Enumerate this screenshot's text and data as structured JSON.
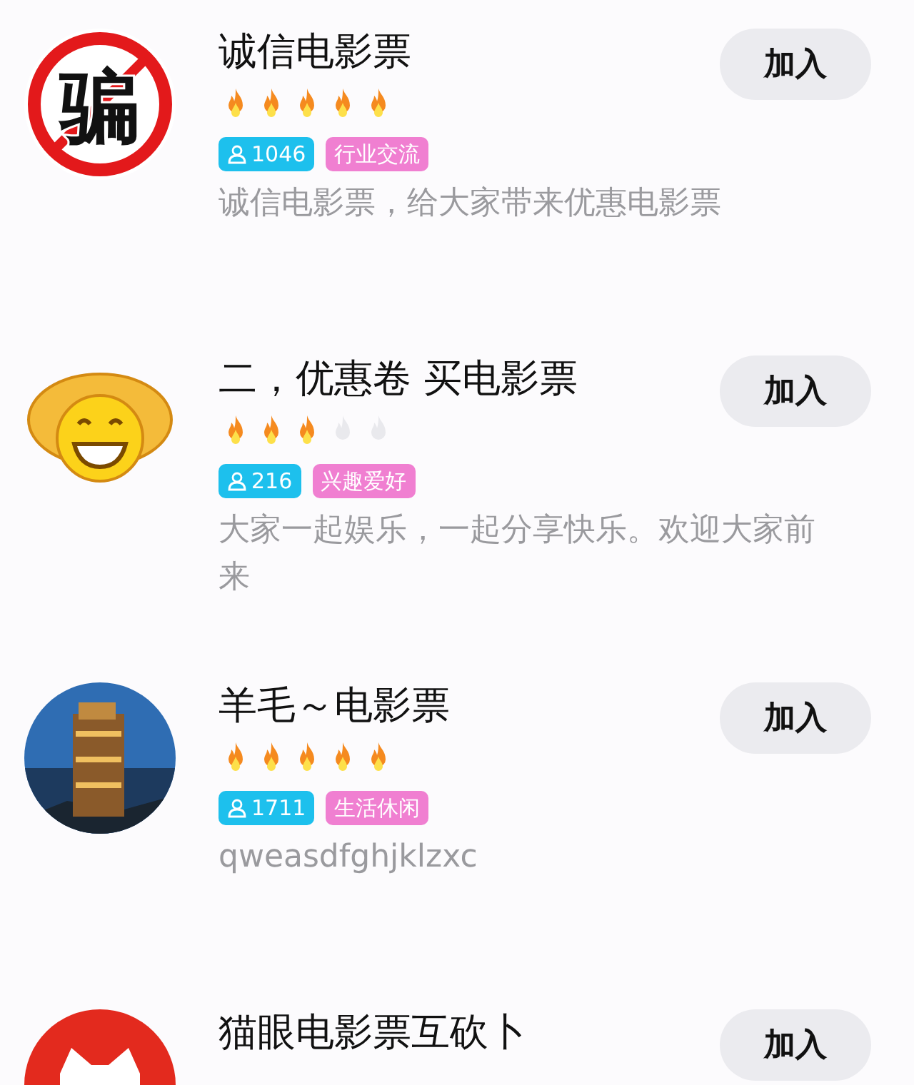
{
  "groups": [
    {
      "avatar": {
        "kind": "ban",
        "text": "骗"
      },
      "title": "诚信电影票",
      "stars": 5,
      "members": "1046",
      "category": "行业交流",
      "description": "诚信电影票，给大家带来优惠电影票",
      "button": "加入"
    },
    {
      "avatar": {
        "kind": "smiley"
      },
      "title": "二，优惠卷 买电影票",
      "stars": 3,
      "members": "216",
      "category": "兴趣爱好",
      "description": "大家一起娱乐，一起分享快乐。欢迎大家前来",
      "button": "加入"
    },
    {
      "title": "羊毛～电影票",
      "stars": 5,
      "members": "1711",
      "category": "生活休闲",
      "description": "qweasdfghjklzxc",
      "button": "加入"
    },
    {
      "avatar": {
        "kind": "cat"
      },
      "title": "猫眼电影票互砍卜",
      "button": "加入"
    }
  ]
}
